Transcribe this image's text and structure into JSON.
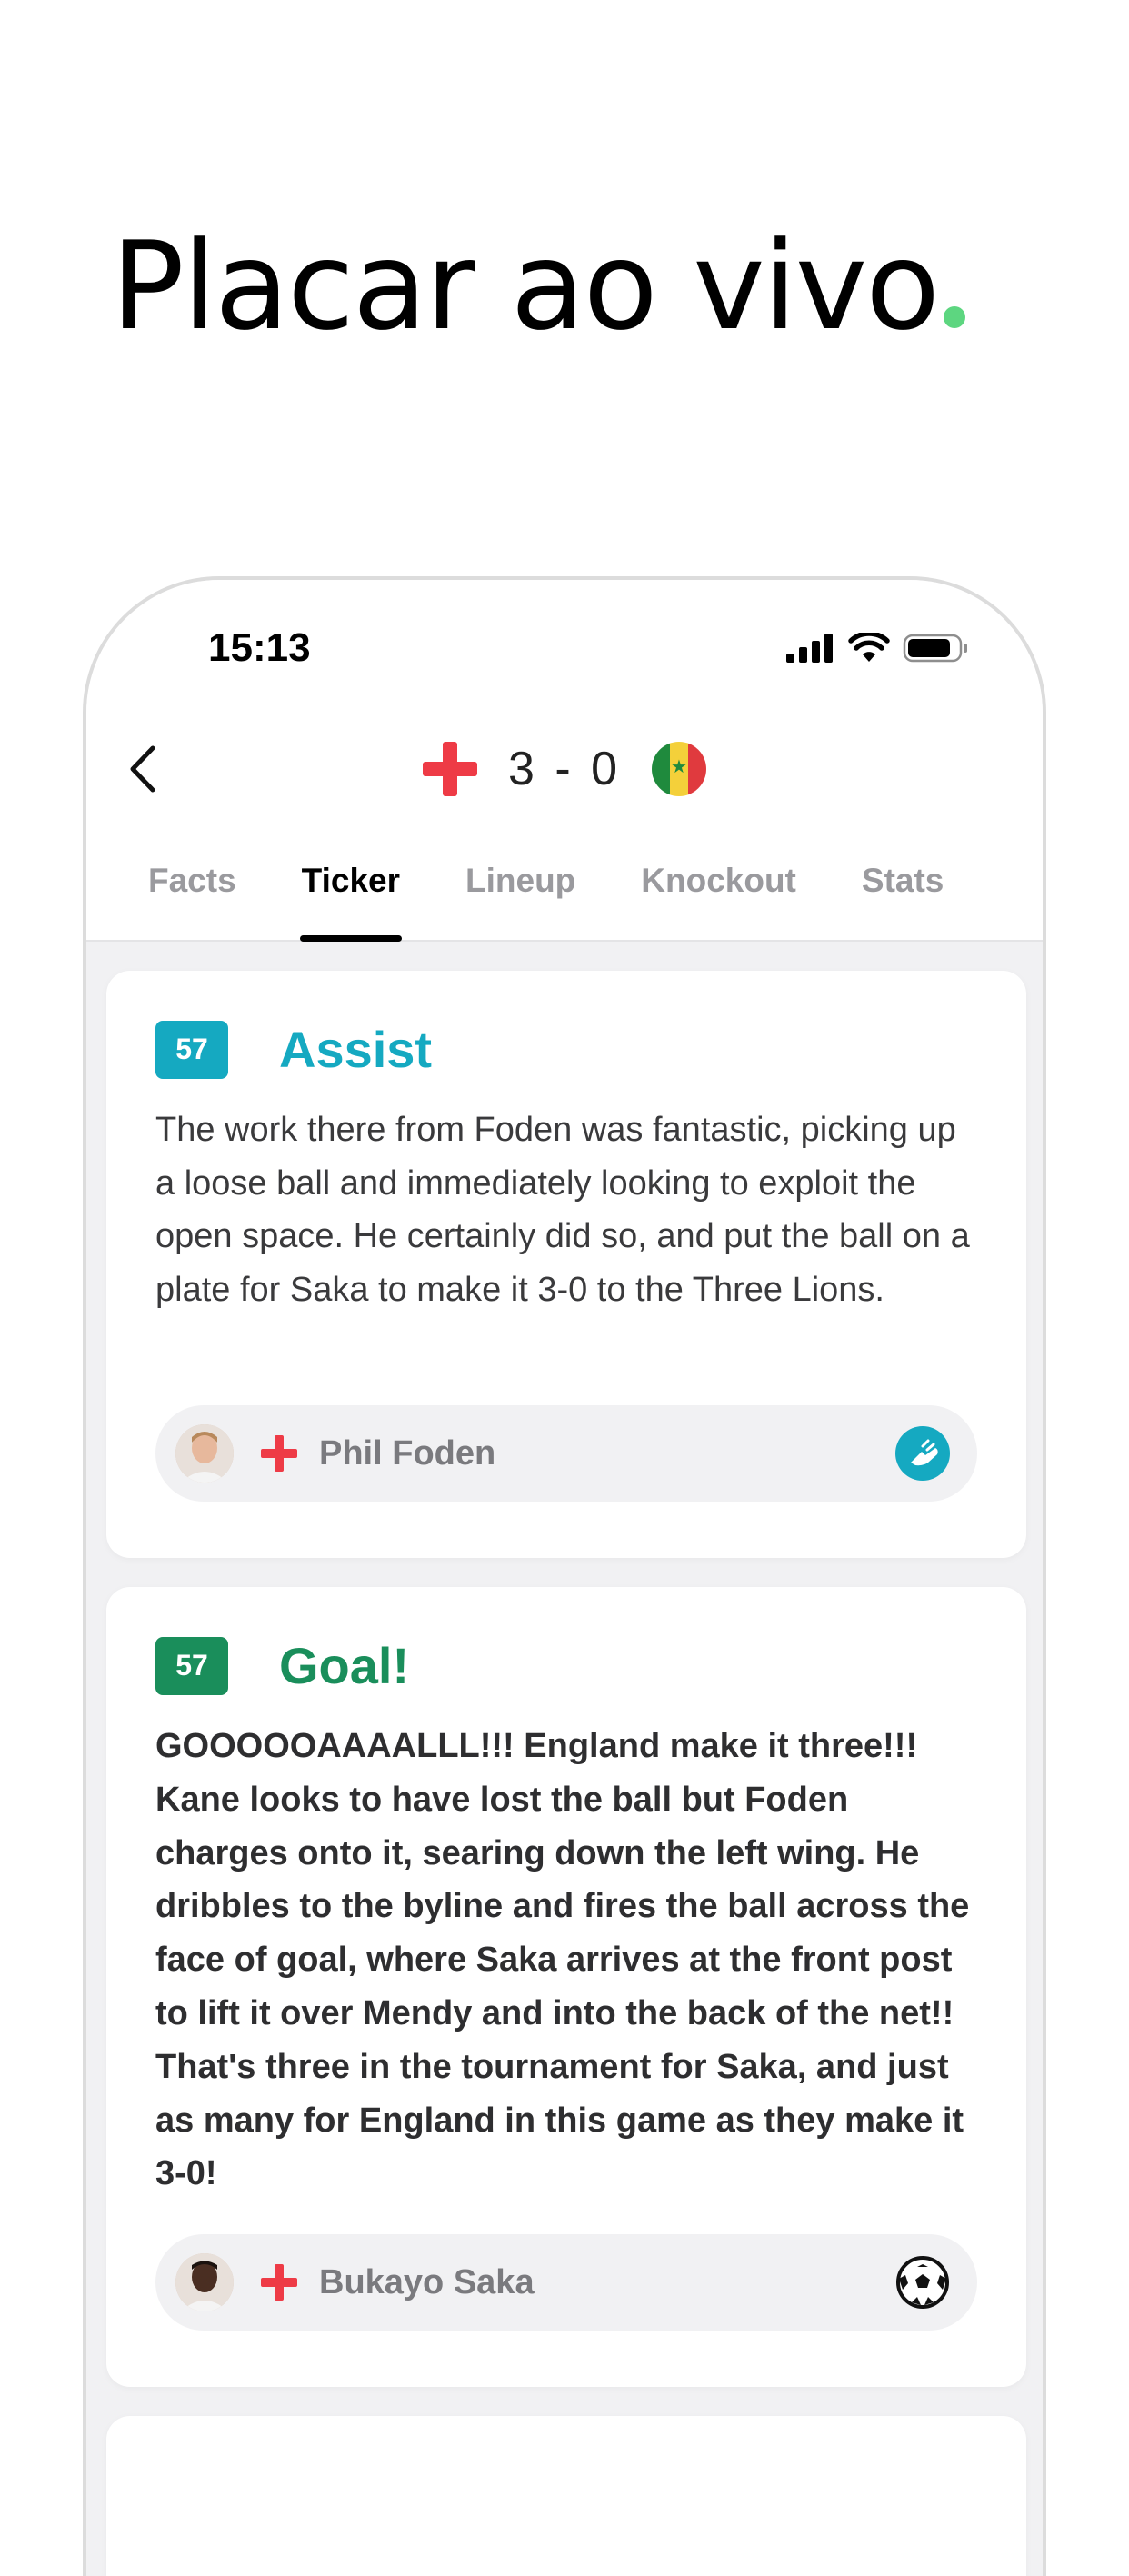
{
  "headline": "Placar ao vivo",
  "colors": {
    "accent_green": "#5dd680",
    "assist": "#15a9c1",
    "goal": "#1a8e5b",
    "england_red": "#ee3b46"
  },
  "status_bar": {
    "time": "15:13",
    "icons": [
      "signal-icon",
      "wifi-icon",
      "battery-icon"
    ]
  },
  "match": {
    "home_flag": "england-flag-icon",
    "home_score": "3",
    "separator": "-",
    "away_score": "0",
    "away_flag": "senegal-flag-icon"
  },
  "tabs": [
    {
      "label": "Facts",
      "active": false
    },
    {
      "label": "Ticker",
      "active": true
    },
    {
      "label": "Lineup",
      "active": false
    },
    {
      "label": "Knockout",
      "active": false
    },
    {
      "label": "Stats",
      "active": false
    }
  ],
  "events": [
    {
      "minute": "57",
      "title": "Assist",
      "text": "The work there from Foden was fantastic, picking up a loose ball and immediately looking to exploit the open space. He certainly did so, and put the ball on a plate for Saka to make it 3-0 to the Three Lions.",
      "player": "Phil Foden",
      "icon": "boot-icon"
    },
    {
      "minute": "57",
      "title": "Goal!",
      "text": "GOOOOOAAAALLL!!! England make it three!!! Kane looks to have lost the ball but Foden charges onto it, searing down the left wing. He dribbles to the byline and fires the ball across the face of goal, where Saka arrives at the front post to lift it over Mendy and into the back of the net!! That's three in the tournament for Saka, and just as many for England in this game as they make it 3-0!",
      "player": "Bukayo Saka",
      "icon": "football-icon"
    }
  ]
}
